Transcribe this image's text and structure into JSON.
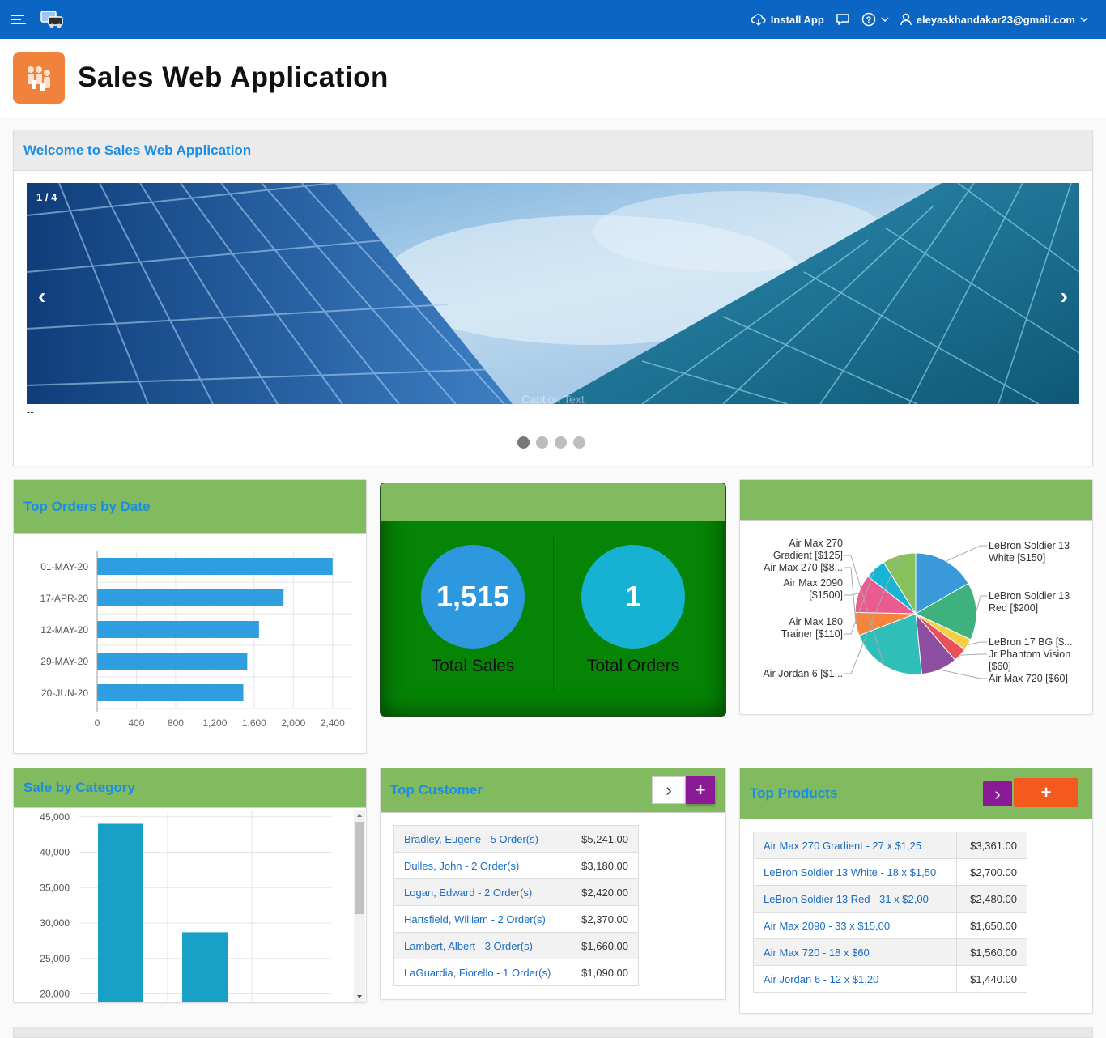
{
  "topbar": {
    "install_label": "Install App",
    "user_email": "eleyaskhandakar23@gmail.com",
    "color": "#0b66c3"
  },
  "page": {
    "title": "Sales Web Application"
  },
  "welcome": {
    "title": "Welcome to Sales Web Application",
    "counter": "1 / 4",
    "prev": "‹",
    "next": "›",
    "caption": "Caption Text",
    "below_text": "--",
    "slides": 4,
    "active_slide": 1
  },
  "top_orders": {
    "title": "Top Orders by Date",
    "chart_data": {
      "type": "bar",
      "orientation": "horizontal",
      "categories": [
        "01-MAY-20",
        "17-APR-20",
        "12-MAY-20",
        "29-MAY-20",
        "20-JUN-20"
      ],
      "values": [
        2400,
        1900,
        1650,
        1530,
        1490
      ],
      "xlim": [
        0,
        2600
      ],
      "ticks": [
        0,
        400,
        800,
        1200,
        1600,
        2000,
        2400
      ],
      "tick_labels": [
        "0",
        "400",
        "800",
        "1,200",
        "1,600",
        "2,000",
        "2,400"
      ],
      "grid": true,
      "color": "#2e9ee0"
    }
  },
  "totals": {
    "sales_value": "1,515",
    "sales_label": "Total Sales",
    "orders_value": "1",
    "orders_label": "Total Orders"
  },
  "products_pie": {
    "chart_data": {
      "type": "pie",
      "slices": [
        {
          "label": "LeBron Soldier 13 White [$150]",
          "value": 2700,
          "color": "#3a9ad9"
        },
        {
          "label": "LeBron Soldier 13 Red [$200]",
          "value": 2480,
          "color": "#3db17e"
        },
        {
          "label": "LeBron 17 BG [$...",
          "value": 500,
          "color": "#f7ce46"
        },
        {
          "label": "Jr Phantom Vision [$60]",
          "value": 600,
          "color": "#e9505a"
        },
        {
          "label": "Air Max 720 [$60]",
          "value": 1560,
          "color": "#8e4fa3"
        },
        {
          "label": "Air Max 270 Gradient [$125]",
          "value": 3361,
          "color": "#2fbfb8"
        },
        {
          "label": "Air Max 270 [$8...",
          "value": 1000,
          "color": "#f5843c"
        },
        {
          "label": "Air Max 2090 [$1500]",
          "value": 1650,
          "color": "#ea5c8f"
        },
        {
          "label": "Air Max 180 Trainer [$110]",
          "value": 900,
          "color": "#18b4d4"
        },
        {
          "label": "Air Jordan 6 [$1...",
          "value": 1440,
          "color": "#86c15b"
        }
      ]
    }
  },
  "sale_by_category": {
    "title": "Sale by Category",
    "chart_data": {
      "type": "bar",
      "categories": [
        "",
        "",
        ""
      ],
      "values": [
        44000,
        28700,
        0
      ],
      "ylim": [
        18800,
        46000
      ],
      "ticks": [
        20000,
        25000,
        30000,
        35000,
        40000,
        45000
      ],
      "tick_labels": [
        "20,000",
        "25,000",
        "30,000",
        "35,000",
        "40,000",
        "45,000"
      ],
      "grid": true,
      "color": "#19a0c7"
    }
  },
  "top_customer": {
    "title": "Top Customer",
    "btn_next": "›",
    "btn_add": "+",
    "rows": [
      {
        "name": "Bradley, Eugene - 5 Order(s)",
        "amount": "$5,241.00"
      },
      {
        "name": "Dulles, John - 2 Order(s)",
        "amount": "$3,180.00"
      },
      {
        "name": "Logan, Edward - 2 Order(s)",
        "amount": "$2,420.00"
      },
      {
        "name": "Hartsfield, William - 2 Order(s)",
        "amount": "$2,370.00"
      },
      {
        "name": "Lambert, Albert - 3 Order(s)",
        "amount": "$1,660.00"
      },
      {
        "name": "LaGuardia, Fiorello - 1 Order(s)",
        "amount": "$1,090.00"
      }
    ]
  },
  "top_products": {
    "title": "Top Products",
    "btn_next": "›",
    "btn_add": "+",
    "rows": [
      {
        "name": "Air Max 270 Gradient - 27 x $1,25",
        "amount": "$3,361.00"
      },
      {
        "name": "LeBron Soldier 13 White - 18 x $1,50",
        "amount": "$2,700.00"
      },
      {
        "name": "LeBron Soldier 13 Red - 31 x $2,00",
        "amount": "$2,480.00"
      },
      {
        "name": "Air Max 2090 - 33 x $15,00",
        "amount": "$1,650.00"
      },
      {
        "name": "Air Max 720 - 18 x $60",
        "amount": "$1,560.00"
      },
      {
        "name": "Air Jordan 6 - 12 x $1,20",
        "amount": "$1,440.00"
      }
    ]
  }
}
